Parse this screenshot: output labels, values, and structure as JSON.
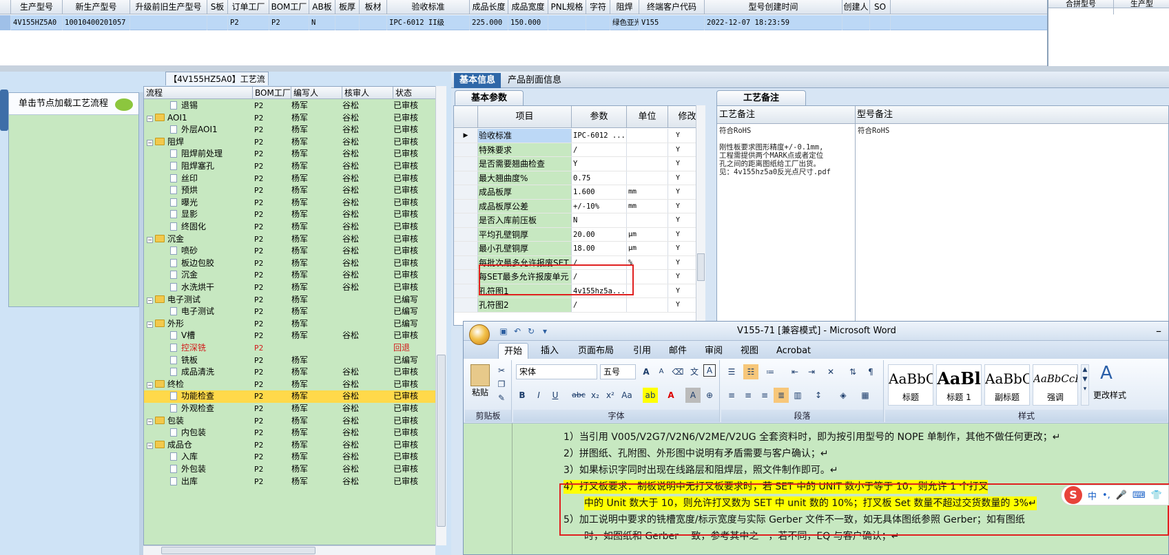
{
  "top_grid": {
    "columns": [
      "生产型号",
      "新生产型号",
      "升级前旧生产型号",
      "S板",
      "订单工厂",
      "BOM工厂",
      "AB板",
      "板厚",
      "板材",
      "验收标准",
      "成品长度",
      "成品宽度",
      "PNL规格",
      "字符",
      "阻焊",
      "终端客户代码",
      "型号创建时间",
      "创建人",
      "SO"
    ],
    "row": [
      "4V155HZ5A0",
      "10010400201057",
      "",
      "",
      "P2",
      "P2",
      "N",
      "",
      "",
      "IPC-6012 II级",
      "225.000",
      "150.000",
      "",
      "",
      "绿色亚光",
      "V155",
      "2022-12-07 18:23:59",
      "",
      ""
    ]
  },
  "side_panel": {
    "columns": [
      "合拼型号",
      "生产型"
    ]
  },
  "left_node_panel": {
    "load_text": "单击节点加载工艺流程"
  },
  "process": {
    "title": "【4V155HZ5A0】工艺流程",
    "columns": [
      "流程",
      "BOM工厂",
      "编写人",
      "核审人",
      "状态"
    ],
    "rows": [
      {
        "name": "退锡",
        "level": 2,
        "bom": "P2",
        "writer": "杨军",
        "reviewer": "谷松",
        "status": "已审核"
      },
      {
        "name": "AOI1",
        "level": 1,
        "bom": "P2",
        "writer": "杨军",
        "reviewer": "谷松",
        "status": "已审核"
      },
      {
        "name": "外层AOI1",
        "level": 2,
        "bom": "P2",
        "writer": "杨军",
        "reviewer": "谷松",
        "status": "已审核"
      },
      {
        "name": "阻焊",
        "level": 1,
        "bom": "P2",
        "writer": "杨军",
        "reviewer": "谷松",
        "status": "已审核"
      },
      {
        "name": "阻焊前处理",
        "level": 2,
        "bom": "P2",
        "writer": "杨军",
        "reviewer": "谷松",
        "status": "已审核"
      },
      {
        "name": "阻焊塞孔",
        "level": 2,
        "bom": "P2",
        "writer": "杨军",
        "reviewer": "谷松",
        "status": "已审核"
      },
      {
        "name": "丝印",
        "level": 2,
        "bom": "P2",
        "writer": "杨军",
        "reviewer": "谷松",
        "status": "已审核"
      },
      {
        "name": "预烘",
        "level": 2,
        "bom": "P2",
        "writer": "杨军",
        "reviewer": "谷松",
        "status": "已审核"
      },
      {
        "name": "曝光",
        "level": 2,
        "bom": "P2",
        "writer": "杨军",
        "reviewer": "谷松",
        "status": "已审核"
      },
      {
        "name": "显影",
        "level": 2,
        "bom": "P2",
        "writer": "杨军",
        "reviewer": "谷松",
        "status": "已审核"
      },
      {
        "name": "终固化",
        "level": 2,
        "bom": "P2",
        "writer": "杨军",
        "reviewer": "谷松",
        "status": "已审核"
      },
      {
        "name": "沉金",
        "level": 1,
        "bom": "P2",
        "writer": "杨军",
        "reviewer": "谷松",
        "status": "已审核"
      },
      {
        "name": "喷砂",
        "level": 2,
        "bom": "P2",
        "writer": "杨军",
        "reviewer": "谷松",
        "status": "已审核"
      },
      {
        "name": "板边包胶",
        "level": 2,
        "bom": "P2",
        "writer": "杨军",
        "reviewer": "谷松",
        "status": "已审核"
      },
      {
        "name": "沉金",
        "level": 2,
        "bom": "P2",
        "writer": "杨军",
        "reviewer": "谷松",
        "status": "已审核"
      },
      {
        "name": "水洗烘干",
        "level": 2,
        "bom": "P2",
        "writer": "杨军",
        "reviewer": "谷松",
        "status": "已审核"
      },
      {
        "name": "电子测试",
        "level": 1,
        "bom": "P2",
        "writer": "杨军",
        "reviewer": "",
        "status": "已编写"
      },
      {
        "name": "电子测试",
        "level": 2,
        "bom": "P2",
        "writer": "杨军",
        "reviewer": "",
        "status": "已编写"
      },
      {
        "name": "外形",
        "level": 1,
        "bom": "P2",
        "writer": "杨军",
        "reviewer": "",
        "status": "已编写"
      },
      {
        "name": "V槽",
        "level": 2,
        "bom": "P2",
        "writer": "杨军",
        "reviewer": "谷松",
        "status": "已审核"
      },
      {
        "name": "控深铣",
        "level": 2,
        "bom": "P2",
        "writer": "",
        "reviewer": "",
        "status": "回退",
        "red": true
      },
      {
        "name": "铣板",
        "level": 2,
        "bom": "P2",
        "writer": "杨军",
        "reviewer": "",
        "status": "已编写"
      },
      {
        "name": "成品清洗",
        "level": 2,
        "bom": "P2",
        "writer": "杨军",
        "reviewer": "谷松",
        "status": "已审核"
      },
      {
        "name": "终检",
        "level": 1,
        "bom": "P2",
        "writer": "杨军",
        "reviewer": "谷松",
        "status": "已审核"
      },
      {
        "name": "功能检查",
        "level": 2,
        "bom": "P2",
        "writer": "杨军",
        "reviewer": "谷松",
        "status": "已审核",
        "selected": true
      },
      {
        "name": "外观检查",
        "level": 2,
        "bom": "P2",
        "writer": "杨军",
        "reviewer": "谷松",
        "status": "已审核"
      },
      {
        "name": "包装",
        "level": 1,
        "bom": "P2",
        "writer": "杨军",
        "reviewer": "谷松",
        "status": "已审核"
      },
      {
        "name": "内包装",
        "level": 2,
        "bom": "P2",
        "writer": "杨军",
        "reviewer": "谷松",
        "status": "已审核"
      },
      {
        "name": "成品仓",
        "level": 1,
        "bom": "P2",
        "writer": "杨军",
        "reviewer": "谷松",
        "status": "已审核"
      },
      {
        "name": "入库",
        "level": 2,
        "bom": "P2",
        "writer": "杨军",
        "reviewer": "谷松",
        "status": "已审核"
      },
      {
        "name": "外包装",
        "level": 2,
        "bom": "P2",
        "writer": "杨军",
        "reviewer": "谷松",
        "status": "已审核"
      },
      {
        "name": "出库",
        "level": 2,
        "bom": "P2",
        "writer": "杨军",
        "reviewer": "谷松",
        "status": "已审核"
      }
    ]
  },
  "right_tabs": [
    "基本信息",
    "产品剖面信息"
  ],
  "params": {
    "tab": "基本参数",
    "columns": [
      "项目",
      "参数",
      "单位",
      "修改"
    ],
    "rows": [
      [
        "验收标准",
        "IPC-6012 ...",
        "",
        "Y"
      ],
      [
        "特殊要求",
        "/",
        "",
        "Y"
      ],
      [
        "是否需要翘曲检查",
        "Y",
        "",
        "Y"
      ],
      [
        "最大翘曲度%",
        "0.75",
        "",
        "Y"
      ],
      [
        "成品板厚",
        "1.600",
        "mm",
        "Y"
      ],
      [
        "成品板厚公差",
        "+/-10%",
        "mm",
        "Y"
      ],
      [
        "是否入库前压板",
        "N",
        "",
        "Y"
      ],
      [
        "平均孔壁铜厚",
        "20.00",
        "μm",
        "Y"
      ],
      [
        "最小孔壁铜厚",
        "18.00",
        "μm",
        "Y"
      ],
      [
        "每批次最多允许报废SET",
        "/",
        "%",
        "Y"
      ],
      [
        "每SET最多允许报废单元",
        "/",
        "",
        "Y"
      ],
      [
        "孔符图1",
        "4v155hz5a...",
        "",
        "Y"
      ],
      [
        "孔符图2",
        "/",
        "",
        "Y"
      ]
    ]
  },
  "remarks": {
    "tab": "工艺备注",
    "col1": "工艺备注",
    "col2": "型号备注",
    "text1": "符合RoHS\n\n刚性板要求图形精度+/-0.1mm,\n工程需提供两个MARK点或者定位\n孔之间的距离图纸给工厂出货。\n见：4v155hz5a0反光点尺寸.pdf",
    "text2": "符合RoHS"
  },
  "word": {
    "title": "V155-71 [兼容模式] - Microsoft Word",
    "close": "–",
    "tabs": [
      "开始",
      "插入",
      "页面布局",
      "引用",
      "邮件",
      "审阅",
      "视图",
      "Acrobat"
    ],
    "groups": {
      "clipboard": "剪贴板",
      "font": "字体",
      "paragraph": "段落",
      "styles": "样式"
    },
    "paste_label": "粘贴",
    "font_name": "宋体",
    "font_size": "五号",
    "styles": [
      {
        "sample": "AaBbC",
        "name": "标题"
      },
      {
        "sample": "AaBl",
        "name": "标题 1"
      },
      {
        "sample": "AaBbC",
        "name": "副标题"
      },
      {
        "sample": "AaBbCcDc",
        "name": "强调"
      }
    ],
    "change_style": "更改样式",
    "lines": [
      "1）当引用 V005/V2G7/V2N6/V2ME/V2UG 全套资料时，即为按引用型号的 NOPE 单制作，其他不做任何更改；↵",
      "2）拼图纸、孔附图、外形图中说明有矛盾需要与客户确认；↵",
      "3）如果标识字同时出现在线路层和阻焊层，照文件制作即可。↵",
      "4）打叉板要求：制板说明中无打叉板要求时，若 SET 中的 UNIT 数小于等于 10，则允许 1 个打叉",
      "中的 Unit 数大于 10，则允许打叉数为 SET 中 unit 数的 10%；打叉板 Set 数量不超过交货数量的 3%↵",
      "5）加工说明中要求的铣槽宽度/标示宽度与实际 Gerber 文件不一致，如无具体图纸参照 Gerber；如有图纸",
      "时，如图纸和 Gerber 一致，参考其中之一，若不同，EQ 与客户确认；↵"
    ]
  },
  "sogou": [
    "S",
    "中",
    "•,",
    "🎤",
    "⌨",
    "👕"
  ]
}
